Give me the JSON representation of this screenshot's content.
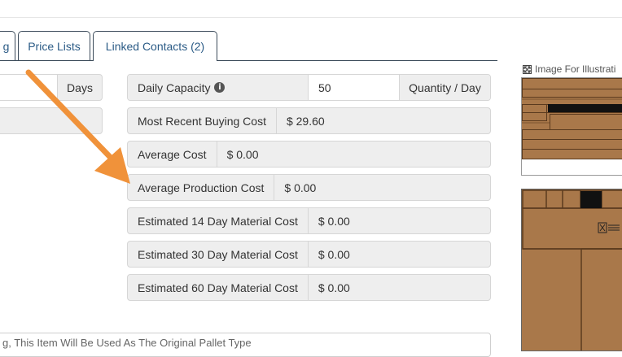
{
  "tabs": [
    {
      "label": "g"
    },
    {
      "label": "Price Lists"
    },
    {
      "label": "Linked Contacts (2)"
    }
  ],
  "left_fields": {
    "days_addon": "Days"
  },
  "daily_capacity": {
    "label": "Daily Capacity",
    "value": "50",
    "unit": "Quantity / Day"
  },
  "cost_rows": [
    {
      "label": "Most Recent Buying Cost",
      "value": "$ 29.60"
    },
    {
      "label": "Average Cost",
      "value": "$ 0.00"
    },
    {
      "label": "Average Production Cost",
      "value": "$ 0.00"
    },
    {
      "label": "Estimated 14 Day Material Cost",
      "value": "$ 0.00"
    },
    {
      "label": "Estimated 30 Day Material Cost",
      "value": "$ 0.00"
    },
    {
      "label": "Estimated 60 Day Material Cost",
      "value": "$ 0.00"
    }
  ],
  "bottom_field": {
    "text": "g, This Item Will Be Used As The Original Pallet Type"
  },
  "image_panel": {
    "caption": "Image For Illustrati"
  },
  "colors": {
    "tab_text": "#2b5b86",
    "tab_border": "#3c4b5a",
    "addon_bg": "#eeeeee",
    "annotation_arrow": "#f0923a",
    "wood": "#a9784a"
  }
}
